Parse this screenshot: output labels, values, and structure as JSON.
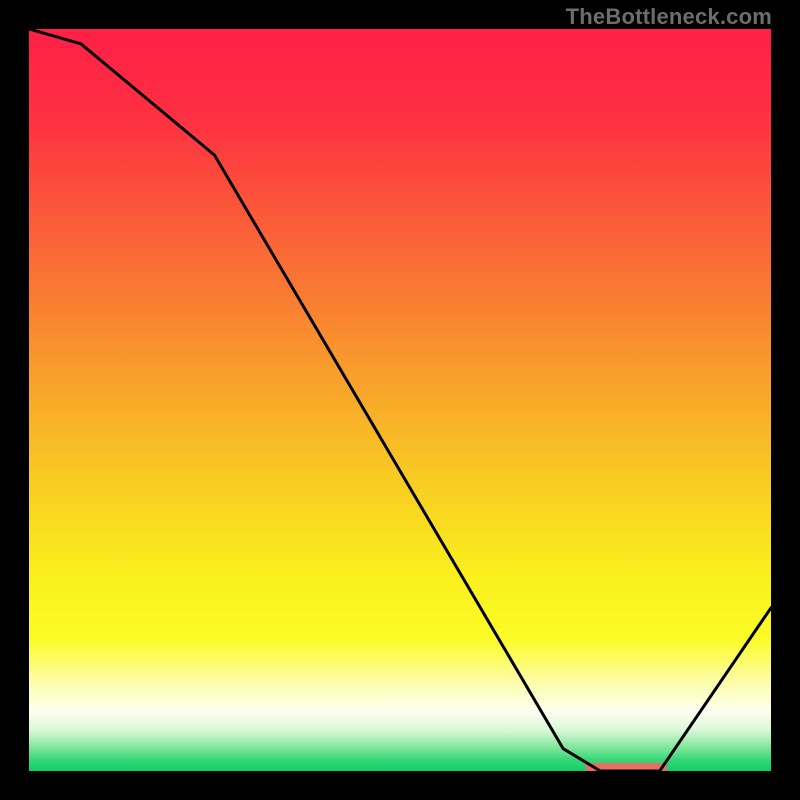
{
  "watermark": "TheBottleneck.com",
  "chart_data": {
    "type": "line",
    "title": "",
    "xlabel": "",
    "ylabel": "",
    "xlim": [
      0,
      100
    ],
    "ylim": [
      0,
      100
    ],
    "x": [
      0,
      7,
      25,
      72,
      77,
      85,
      100
    ],
    "y": [
      100,
      98,
      83,
      3,
      0,
      0,
      22
    ],
    "optimum_band": {
      "x_start": 75,
      "x_end": 86,
      "y": 0
    },
    "background_gradient": {
      "stops": [
        {
          "pos": 0.0,
          "color": "#ff1f46"
        },
        {
          "pos": 0.12,
          "color": "#fe3042"
        },
        {
          "pos": 0.25,
          "color": "#fb5939"
        },
        {
          "pos": 0.38,
          "color": "#f98231"
        },
        {
          "pos": 0.5,
          "color": "#f8aa29"
        },
        {
          "pos": 0.62,
          "color": "#f8cf22"
        },
        {
          "pos": 0.74,
          "color": "#faf01d"
        },
        {
          "pos": 0.82,
          "color": "#fbfb25"
        },
        {
          "pos": 0.885,
          "color": "#fdfdb4"
        },
        {
          "pos": 0.92,
          "color": "#fefef1"
        },
        {
          "pos": 0.945,
          "color": "#d8f8d7"
        },
        {
          "pos": 0.965,
          "color": "#8fe9a2"
        },
        {
          "pos": 0.985,
          "color": "#36d777"
        },
        {
          "pos": 1.0,
          "color": "#10cf67"
        }
      ]
    }
  }
}
